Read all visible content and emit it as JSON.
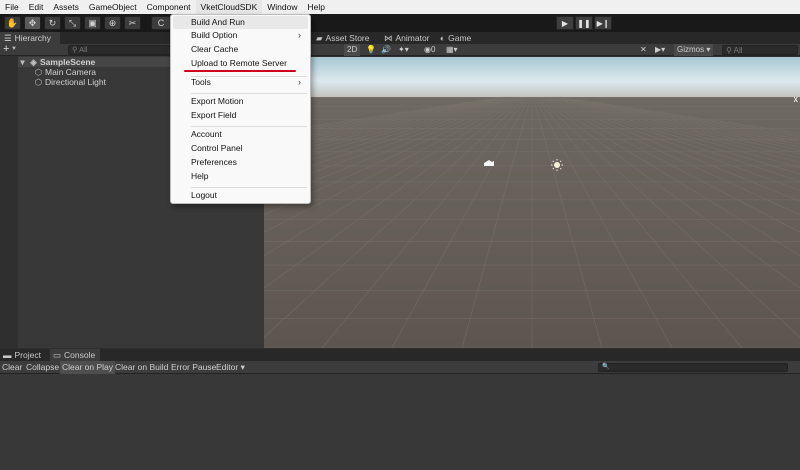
{
  "menubar": {
    "items": [
      "File",
      "Edit",
      "Assets",
      "GameObject",
      "Component",
      "VketCloudSDK",
      "Window",
      "Help"
    ]
  },
  "toolbar": {
    "tools": [
      {
        "icon": "hand-icon",
        "glyph": "✋"
      },
      {
        "icon": "move-icon",
        "glyph": "✥"
      },
      {
        "icon": "rotate-icon",
        "glyph": "↻"
      },
      {
        "icon": "scale-icon",
        "glyph": "⤡"
      },
      {
        "icon": "rect-icon",
        "glyph": "▣"
      },
      {
        "icon": "transform-icon",
        "glyph": "⊕"
      },
      {
        "icon": "custom-tool-icon",
        "glyph": "✂"
      }
    ],
    "center_label": "C"
  },
  "hierarchy": {
    "tab_label": "Hierarchy",
    "search_placeholder": "All",
    "items": [
      {
        "label": "SampleScene",
        "icon": "scene-icon"
      },
      {
        "label": "Main Camera",
        "icon": "gameobject-icon"
      },
      {
        "label": "Directional Light",
        "icon": "gameobject-icon"
      }
    ]
  },
  "scene": {
    "tabs": [
      "Asset Store",
      "Animator",
      "Game"
    ],
    "toolbar": {
      "mode_2d": "2D",
      "effects_count": "0",
      "gizmos": "Gizmos",
      "search_placeholder": "All"
    },
    "close": "x"
  },
  "bottom": {
    "tabs": [
      "Project",
      "Console"
    ],
    "console_buttons": [
      "Clear",
      "Collapse",
      "Clear on Play",
      "Clear on Build",
      "Error Pause",
      "Editor ▾"
    ],
    "search_glyph": "🔍"
  },
  "dropdown": {
    "items": [
      "Build And Run",
      "Build Option",
      "Clear Cache",
      "Upload to Remote Server",
      "Tools",
      "Export Motion",
      "Export Field",
      "Account",
      "Control Panel",
      "Preferences",
      "Help",
      "Logout"
    ],
    "submenu_glyph": "›"
  },
  "colors": {
    "annotation_underline": "#d0021b",
    "sky": "#c9dde6",
    "ground": "#5e5752"
  }
}
